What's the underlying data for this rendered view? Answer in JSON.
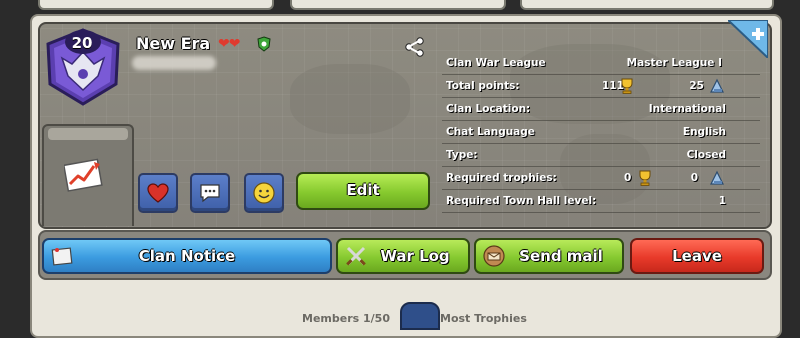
{
  "clan": {
    "level": "20",
    "name": "New Era"
  },
  "stats": {
    "rows": [
      {
        "label": "Clan War League",
        "value": "Master League I"
      },
      {
        "label": "Total points:",
        "value1": "111",
        "value2": "25"
      },
      {
        "label": "Clan Location:",
        "value": "International"
      },
      {
        "label": "Chat Language",
        "value": "English"
      },
      {
        "label": "Type:",
        "value": "Closed"
      },
      {
        "label": "Required trophies:",
        "value1": "0",
        "value2": "0"
      },
      {
        "label": "Required Town Hall level:",
        "value": "1"
      }
    ]
  },
  "buttons": {
    "edit": "Edit",
    "clan_notice": "Clan Notice",
    "war_log": "War Log",
    "send_mail": "Send mail",
    "leave": "Leave"
  },
  "footer": {
    "members": "Members 1/50",
    "tab_label": "Most Trophies"
  },
  "icons": [
    "share-icon",
    "trophy-icon",
    "builder-trophy-icon",
    "heart-icon",
    "chat-icon",
    "smiley-icon",
    "stats-chart-icon",
    "crossed-swords-icon",
    "mail-icon",
    "notice-icon"
  ],
  "colors": {
    "accent_green": "#86c930",
    "accent_blue": "#3b9be0",
    "accent_red": "#e83a2a",
    "badge_purple": "#6a4fc4"
  }
}
